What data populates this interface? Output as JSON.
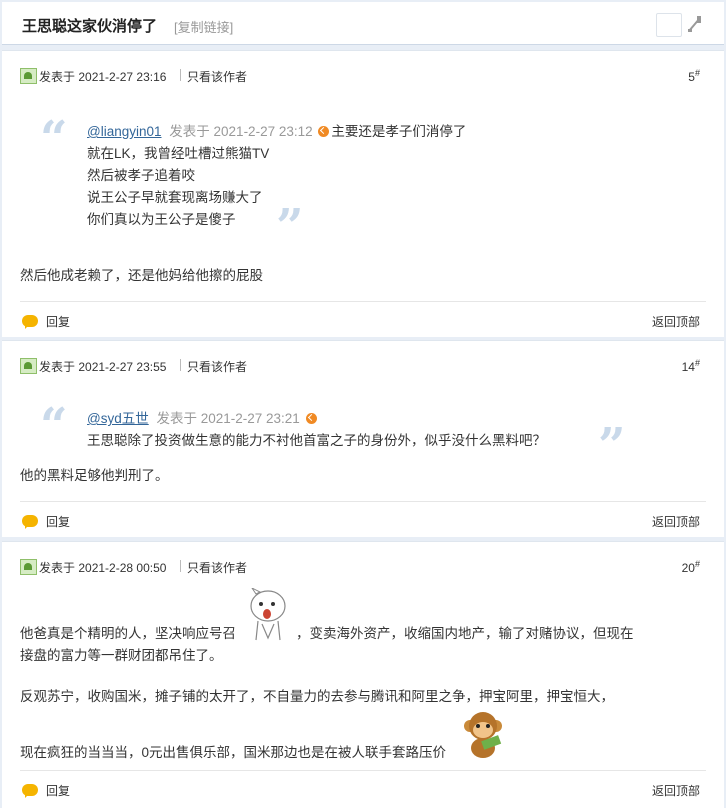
{
  "header": {
    "title": "王思聪这家伙消停了",
    "copy_link": "[复制链接]"
  },
  "common": {
    "posted_prefix": "发表于",
    "only_author": "只看该作者",
    "reply": "回复",
    "back_top": "返回顶部"
  },
  "posts": [
    {
      "date": "2021-2-27 23:16",
      "floor": "5",
      "quote": {
        "user": "@liangyin01",
        "meta": "发表于 2021-2-27 23:12",
        "first_line": "主要还是孝子们消停了",
        "lines": [
          "就在LK，我曾经吐槽过熊猫TV",
          "然后被孝子追着咬",
          "说王公子早就套现离场赚大了",
          "你们真以为王公子是傻子"
        ]
      },
      "content": [
        "然后他成老赖了，还是他妈给他擦的屁股"
      ]
    },
    {
      "date": "2021-2-27 23:55",
      "floor": "14",
      "quote": {
        "user": "@syd五世",
        "meta": "发表于 2021-2-27 23:21",
        "first_line": "",
        "lines": [
          "王思聪除了投资做生意的能力不衬他首富之子的身份外，似乎没什么黑料吧？"
        ]
      },
      "content": [
        "他的黑料足够他判刑了。"
      ]
    },
    {
      "date": "2021-2-28 00:50",
      "floor": "20",
      "content": [
        "他爸真是个精明的人，坚决响应号召",
        "，变卖海外资产，收缩国内地产，输了对赌协议，但现在",
        "接盘的富力等一群财团都吊住了。",
        "反观苏宁，收购国米，摊子铺的太开了，不自量力的去参与腾讯和阿里之争，押宝阿里，押宝恒大，",
        "现在疯狂的当当当，0元出售俱乐部，国米那边也是在被人联手套路压价"
      ]
    }
  ],
  "colors": {
    "background": "#e8eef6",
    "link": "#336699",
    "quote_mark": "#c9d9ea",
    "reply_bubble": "#f5b400"
  },
  "icons": [
    "slide-toggle-icon",
    "avatar-icon",
    "reply-arrow-icon",
    "reply-bubble-icon",
    "surprised-rabbit-emoji",
    "monkey-money-emoji"
  ]
}
